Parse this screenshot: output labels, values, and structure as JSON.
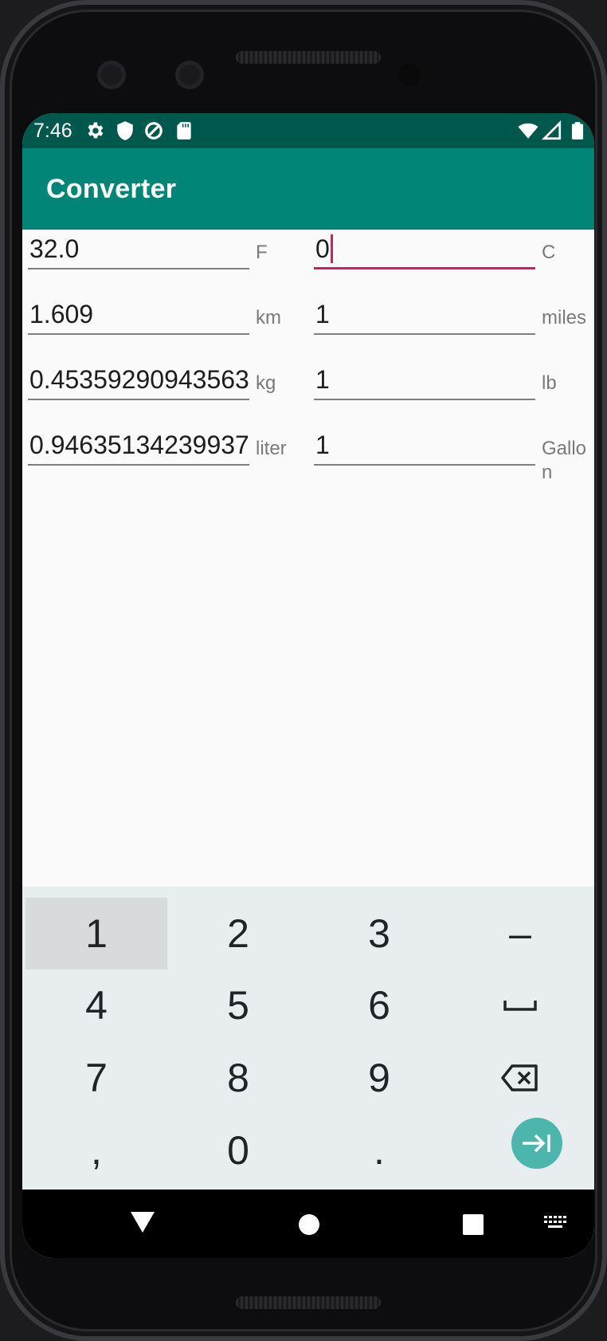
{
  "statusbar": {
    "time": "7:46",
    "icons": [
      "gear-icon",
      "shield-icon",
      "data-saver-icon",
      "sd-card-icon",
      "wifi-icon",
      "signal-icon",
      "battery-icon"
    ]
  },
  "appbar": {
    "title": "Converter"
  },
  "rows": [
    {
      "left_value": "32.0",
      "left_unit": "F",
      "right_value": "0",
      "right_unit": "C"
    },
    {
      "left_value": "1.609",
      "left_unit": "km",
      "right_value": "1",
      "right_unit": "miles"
    },
    {
      "left_value": "0.45359290943563",
      "left_unit": "kg",
      "right_value": "1",
      "right_unit": "lb"
    },
    {
      "left_value": "0.94635134239937",
      "left_unit": "liter",
      "right_value": "1",
      "right_unit": "Gallon"
    }
  ],
  "keyboard": {
    "keys": [
      "1",
      "2",
      "3",
      "–",
      "4",
      "5",
      "6",
      "space",
      "7",
      "8",
      "9",
      "backspace",
      ",",
      "0",
      ".",
      "next"
    ]
  },
  "colors": {
    "status_bar": "#00574b",
    "app_bar": "#008577",
    "focus_accent": "#d81b60",
    "enter_key": "#4db6ac"
  }
}
